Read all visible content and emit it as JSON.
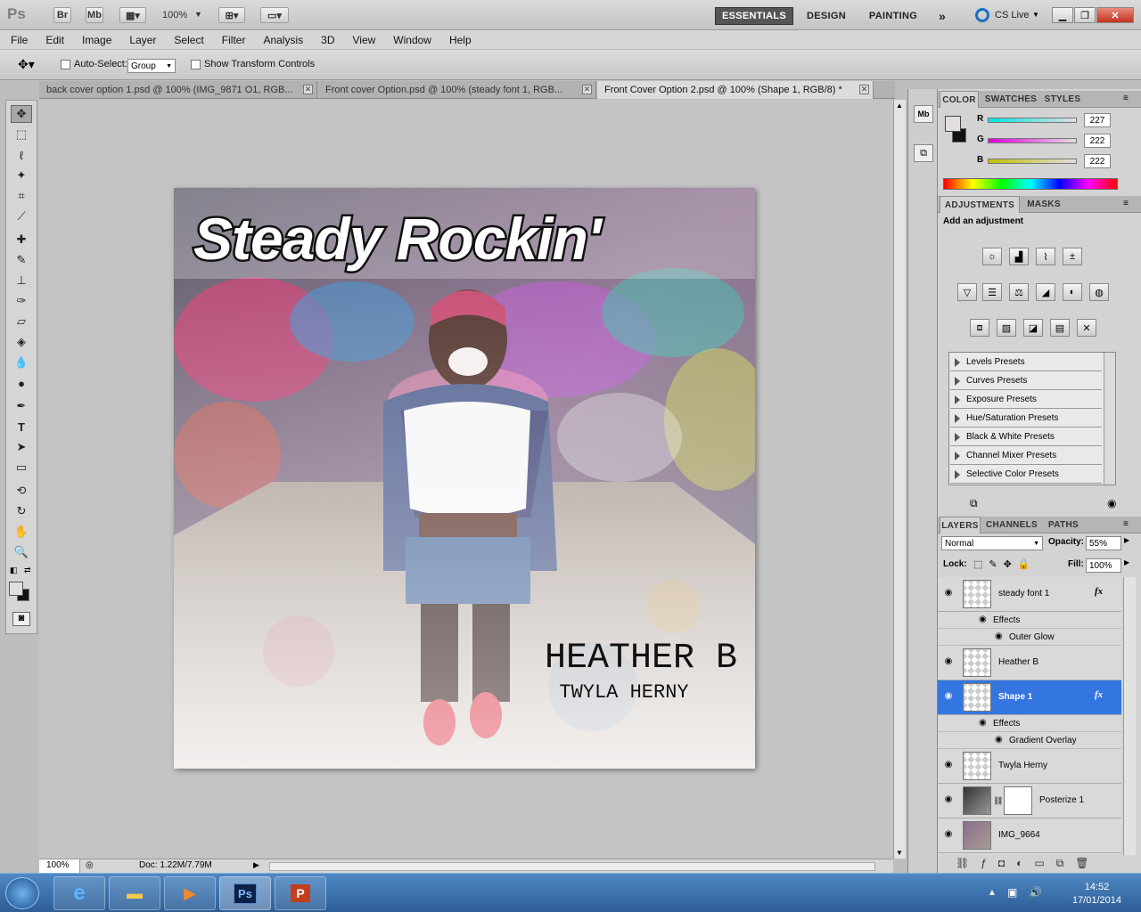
{
  "app": {
    "logo": "Ps",
    "bridge_btn": "Br",
    "minibridge_btn": "Mb",
    "zoom": "100%",
    "workspaces": [
      "ESSENTIALS",
      "DESIGN",
      "PAINTING"
    ],
    "more_workspaces": "»",
    "cslive": "CS Live"
  },
  "menu": [
    "File",
    "Edit",
    "Image",
    "Layer",
    "Select",
    "Filter",
    "Analysis",
    "3D",
    "View",
    "Window",
    "Help"
  ],
  "options": {
    "auto_select_label": "Auto-Select:",
    "auto_select_value": "Group",
    "transform_label": "Show Transform Controls"
  },
  "tabs": [
    {
      "label": "back cover option 1.psd @ 100% (IMG_9871 O1, RGB..."
    },
    {
      "label": "Front cover Option.psd @ 100% (steady font 1, RGB..."
    },
    {
      "label": "Front Cover Option 2.psd @ 100% (Shape 1, RGB/8) *"
    }
  ],
  "artwork": {
    "title": "Steady Rockin'",
    "artist": "HEATHER B",
    "subtitle": "TWYLA HERNY"
  },
  "status": {
    "zoom": "100%",
    "doc": "Doc: 1.22M/7.79M"
  },
  "color_panel": {
    "tabs": [
      "COLOR",
      "SWATCHES",
      "STYLES"
    ],
    "channels": [
      {
        "label": "R",
        "value": "227",
        "color": "#00c8c8"
      },
      {
        "label": "G",
        "value": "222",
        "color": "#e000e0"
      },
      {
        "label": "B",
        "value": "222",
        "color": "#e0e000"
      }
    ]
  },
  "adjustments": {
    "tabs": [
      "ADJUSTMENTS",
      "MASKS"
    ],
    "heading": "Add an adjustment",
    "presets": [
      "Levels Presets",
      "Curves Presets",
      "Exposure Presets",
      "Hue/Saturation Presets",
      "Black & White Presets",
      "Channel Mixer Presets",
      "Selective Color Presets"
    ]
  },
  "layers_panel": {
    "tabs": [
      "LAYERS",
      "CHANNELS",
      "PATHS"
    ],
    "blend_mode": "Normal",
    "opacity_label": "Opacity:",
    "opacity": "55%",
    "lock_label": "Lock:",
    "fill_label": "Fill:",
    "fill": "100%",
    "layers": [
      {
        "name": "steady font 1",
        "fx": "fx"
      },
      {
        "name": "Heather B"
      },
      {
        "name": "Shape 1",
        "fx": "fx"
      },
      {
        "name": "Twyla Herny"
      },
      {
        "name": "Posterize 1"
      },
      {
        "name": "IMG_9664"
      }
    ],
    "effects_label": "Effects",
    "effect_outer_glow": "Outer Glow",
    "effect_gradient": "Gradient Overlay",
    "accent": "#3476e0"
  },
  "taskbar": {
    "time": "14:52",
    "date": "17/01/2014"
  }
}
